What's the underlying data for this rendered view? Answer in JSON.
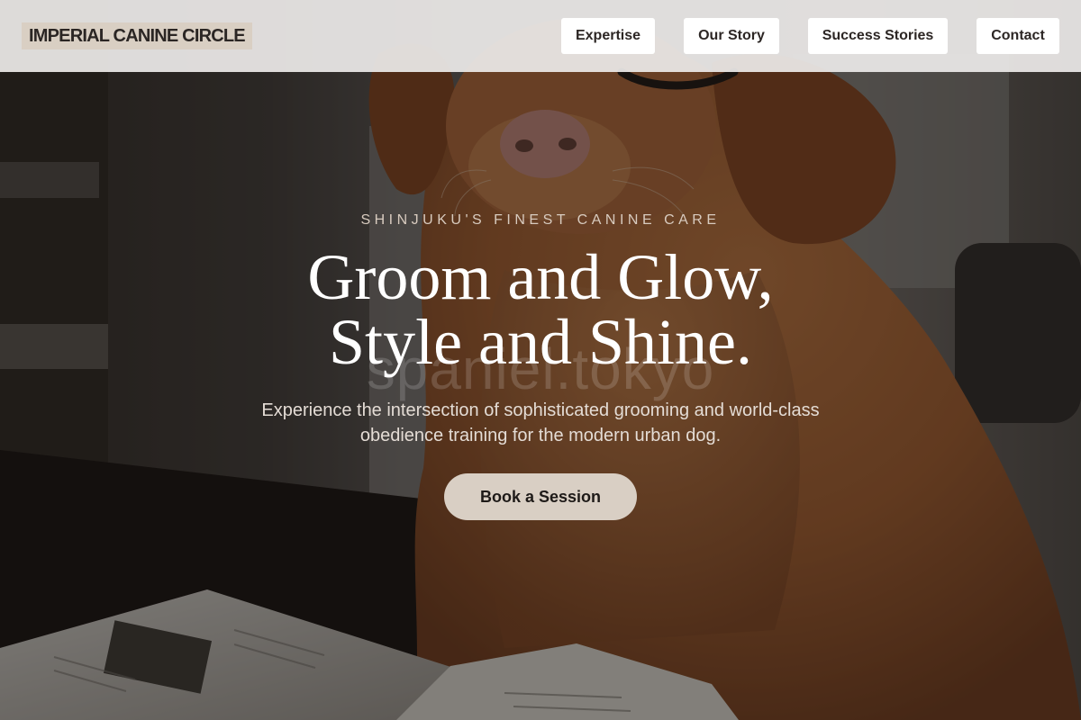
{
  "brand": {
    "name": "IMPERIAL CANINE CIRCLE"
  },
  "nav": {
    "items": [
      {
        "label": "Expertise"
      },
      {
        "label": "Our Story"
      },
      {
        "label": "Success Stories"
      },
      {
        "label": "Contact"
      }
    ]
  },
  "hero": {
    "eyebrow": "SHINJUKU'S FINEST CANINE CARE",
    "watermark": "spaniel.tokyo",
    "headline_line1": "Groom and Glow,",
    "headline_line2": "Style and Shine.",
    "description": "Experience the intersection of sophisticated grooming and world-class obedience training for the modern urban dog.",
    "cta_label": "Book a Session",
    "image": "golden retriever wearing glasses beside an open book"
  },
  "colors": {
    "header_bg": "#eceae8",
    "brand_bg": "#d9cfc3",
    "cta_bg": "#d9cfc4",
    "text_dark": "#2c2624",
    "hero_text": "#ffffff"
  }
}
